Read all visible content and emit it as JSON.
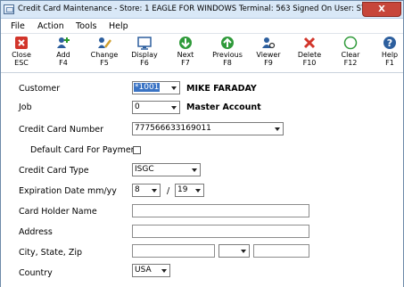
{
  "window": {
    "title": "Credit Card Maintenance - Store: 1   EAGLE FOR WINDOWS   Terminal: 563   Signed On User: SYSTEM",
    "close_glyph": "X"
  },
  "menu": [
    "File",
    "Action",
    "Tools",
    "Help"
  ],
  "toolbar": [
    {
      "label": "Close",
      "key": "ESC",
      "icon": "close-red-x-icon"
    },
    {
      "label": "Add",
      "key": "F4",
      "icon": "add-icon"
    },
    {
      "label": "Change",
      "key": "F5",
      "icon": "change-pencil-icon"
    },
    {
      "label": "Display",
      "key": "F6",
      "icon": "display-monitor-icon"
    },
    {
      "label": "Next",
      "key": "F7",
      "icon": "next-down-arrow-icon"
    },
    {
      "label": "Previous",
      "key": "F8",
      "icon": "previous-up-arrow-icon"
    },
    {
      "label": "Viewer",
      "key": "F9",
      "icon": "viewer-icon"
    },
    {
      "label": "Delete",
      "key": "F10",
      "icon": "delete-red-x-icon"
    },
    {
      "label": "Clear",
      "key": "F12",
      "icon": "clear-circle-icon"
    },
    {
      "label": "Help",
      "key": "F1",
      "icon": "help-question-icon"
    }
  ],
  "form": {
    "customer": {
      "label": "Customer",
      "value": "*1001",
      "name": "MIKE FARADAY"
    },
    "job": {
      "label": "Job",
      "value": "0",
      "name": "Master Account"
    },
    "card_number": {
      "label": "Credit Card Number",
      "value": "777566633169011"
    },
    "default_card": {
      "label": "Default Card For Payment",
      "checked": false
    },
    "card_type": {
      "label": "Credit Card Type",
      "value": "ISGC"
    },
    "expiration": {
      "label": "Expiration Date mm/yy",
      "month": "8",
      "separator": "/",
      "year": "19"
    },
    "holder_name": {
      "label": "Card Holder Name",
      "value": ""
    },
    "address": {
      "label": "Address",
      "value": ""
    },
    "city_state_zip": {
      "label": "City, State, Zip",
      "city": "",
      "state": "",
      "zip": ""
    },
    "country": {
      "label": "Country",
      "value": "USA"
    }
  }
}
